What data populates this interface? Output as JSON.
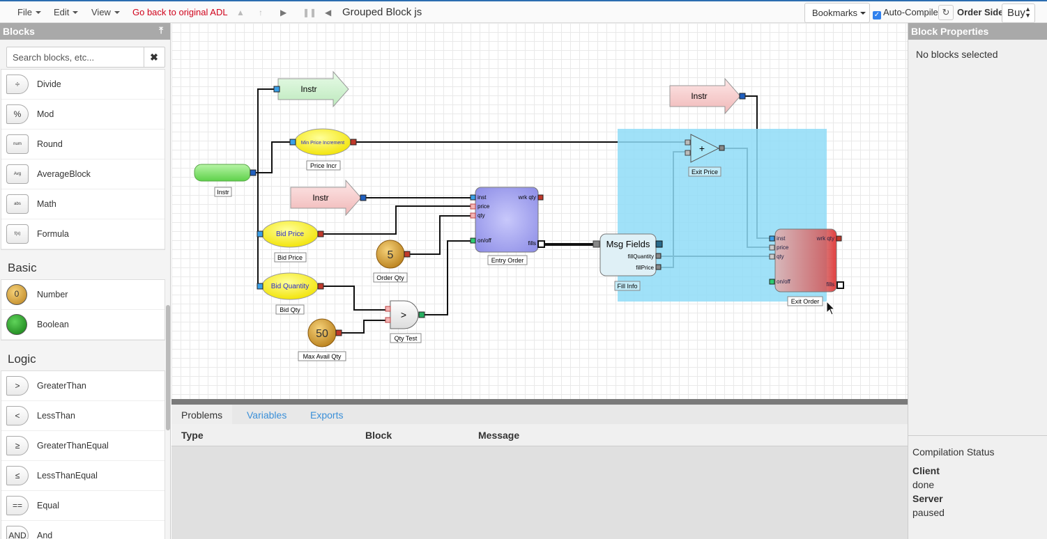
{
  "toolbar": {
    "file": "File",
    "edit": "Edit",
    "view": "View",
    "go_back": "Go back to original ADL",
    "doc_title": "Grouped Block js",
    "bookmarks": "Bookmarks",
    "auto_compile": "Auto-Compile",
    "order_side_label": "Order Side",
    "order_side_value": "Buy"
  },
  "left_panel": {
    "title": "Blocks",
    "search_placeholder": "Search blocks, etc...",
    "math_items": [
      {
        "label": "Divide",
        "icon": "÷"
      },
      {
        "label": "Mod",
        "icon": "%"
      },
      {
        "label": "Round",
        "icon": "num"
      },
      {
        "label": "AverageBlock",
        "icon": "Avg"
      },
      {
        "label": "Math",
        "icon": "abs"
      },
      {
        "label": "Formula",
        "icon": "f(x)"
      }
    ],
    "basic_title": "Basic",
    "basic_items": [
      {
        "label": "Number",
        "icon": "0"
      },
      {
        "label": "Boolean",
        "icon": ""
      }
    ],
    "logic_title": "Logic",
    "logic_items": [
      {
        "label": "GreaterThan",
        "icon": ">"
      },
      {
        "label": "LessThan",
        "icon": "<"
      },
      {
        "label": "GreaterThanEqual",
        "icon": "≥"
      },
      {
        "label": "LessThanEqual",
        "icon": "≤"
      },
      {
        "label": "Equal",
        "icon": "=="
      },
      {
        "label": "And",
        "icon": "AND"
      }
    ]
  },
  "canvas": {
    "instr_source_label": "Instr",
    "instr1": "Instr",
    "instr2": "Instr",
    "instr3": "Instr",
    "min_price_increment": "Min Price Increment",
    "price_incr_label": "Price Incr",
    "bid_price": "Bid Price",
    "bid_price_label": "Bid Price",
    "bid_quantity": "Bid Quantity",
    "bid_qty_label": "Bid Qty",
    "order_qty_value": "5",
    "order_qty_label": "Order Qty",
    "max_avail_value": "50",
    "max_avail_label": "Max Avail Qty",
    "qty_test_symbol": ">",
    "qty_test_label": "Qty Test",
    "entry_order_label": "Entry Order",
    "entry_ports": {
      "inst": "inst",
      "price": "price",
      "qty": "qty",
      "onoff": "on/off",
      "wrk_qty": "wrk qty",
      "fills": "fills"
    },
    "msg_fields_title": "Msg Fields",
    "fill_quantity": "fillQuantity",
    "fill_price": "fillPrice",
    "fill_info_label": "Fill Info",
    "plus_symbol": "+",
    "exit_price_label": "Exit Price",
    "exit_order_label": "Exit Order",
    "exit_ports": {
      "inst": "inst",
      "price": "price",
      "qty": "qty",
      "onoff": "on/off",
      "wrk_qty": "wrk qty",
      "fills": "fills"
    }
  },
  "bottom_panel": {
    "tabs": [
      "Problems",
      "Variables",
      "Exports"
    ],
    "columns": [
      "Type",
      "Block",
      "Message"
    ]
  },
  "right_panel": {
    "title": "Block Properties",
    "no_selection": "No blocks selected",
    "compilation_title": "Compilation Status",
    "client_label": "Client",
    "client_value": "done",
    "server_label": "Server",
    "server_value": "paused"
  },
  "colors": {
    "accent": "#3a8fd8",
    "selection": "#8fdcf7",
    "go_back": "#d0021b"
  }
}
